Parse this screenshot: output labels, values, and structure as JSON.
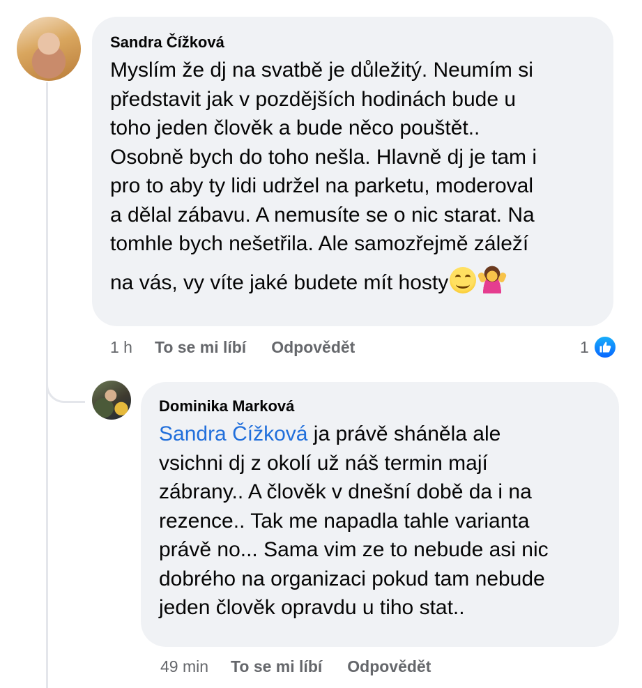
{
  "comments": [
    {
      "author": "Sandra Čížková",
      "lines": [
        "Myslím že dj na svatbě je důležitý. Neumím si",
        "představit jak v pozdějších hodinách bude u",
        "toho jeden člověk a bude něco pouštět..",
        "Osobně bych do toho nešla. Hlavně dj je tam i",
        "pro to aby ty lidi udržel na parketu, moderoval",
        "a dělal zábavu. A nemusíte se o nic starat. Na",
        "tomhle bych nešetřila. Ale samozřejmě záleží",
        "na vás, vy víte jaké budete mít hosty"
      ],
      "emojis": [
        "smiling-face-icon",
        "person-shrugging-icon"
      ],
      "time": "1 h",
      "like_label": "To se mi líbí",
      "reply_label": "Odpovědět",
      "reaction_count": "1",
      "reaction_icon": "like-icon"
    },
    {
      "author": "Dominika Marková",
      "mention": "Sandra Čížková",
      "first_line_rest": " ja právě sháněla ale",
      "lines": [
        "vsichni dj z okolí už náš termin mají",
        "zábrany.. A člověk v dnešní době da i na",
        "rezence.. Tak me napadla tahle varianta",
        "právě no... Sama vim ze to nebude asi nic",
        "dobrého na organizaci pokud tam nebude",
        "jeden člověk opravdu u tiho stat.."
      ],
      "time": "49 min",
      "like_label": "To se mi líbí",
      "reply_label": "Odpovědět"
    }
  ],
  "colors": {
    "bubble": "#f0f2f5",
    "mention": "#216fdb",
    "meta": "#65676b",
    "like_blue": "#0866ff"
  }
}
